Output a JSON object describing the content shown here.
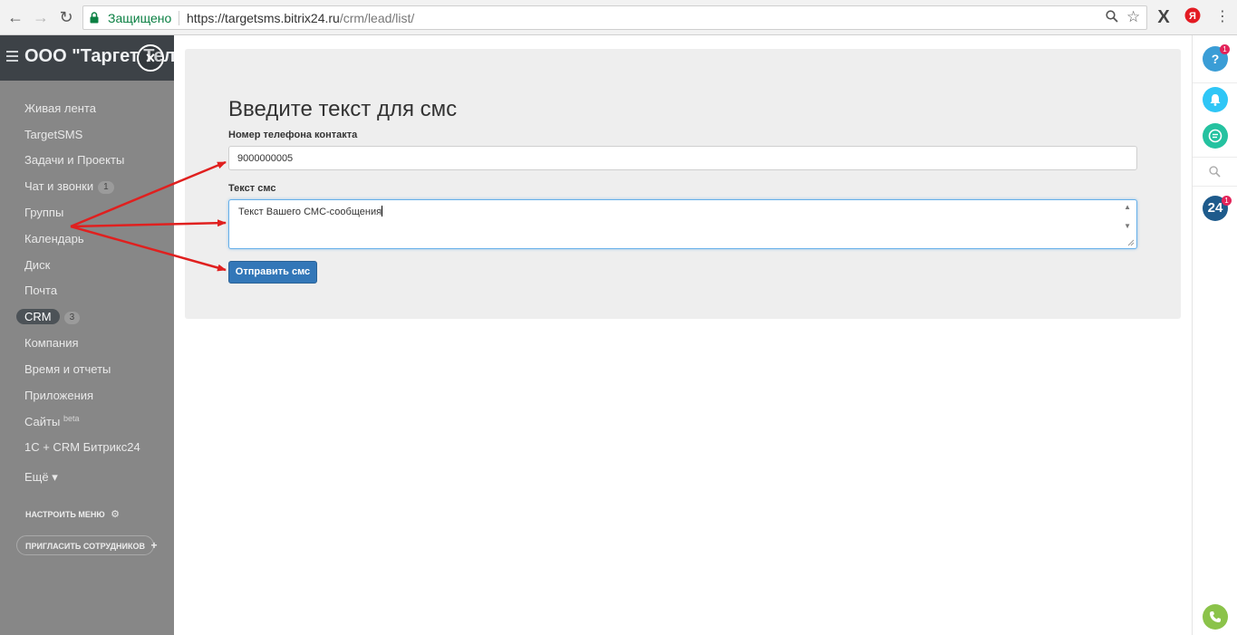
{
  "browser": {
    "secure_label": "Защищено",
    "url_host": "https://targetsms.bitrix24.ru",
    "url_path": "/crm/lead/list/"
  },
  "sidebar": {
    "company": "ООО \"Таргет Телеком\"",
    "items": [
      {
        "label": "Живая лента"
      },
      {
        "label": "TargetSMS"
      },
      {
        "label": "Задачи и Проекты"
      },
      {
        "label": "Чат и звонки",
        "counter": "1"
      },
      {
        "label": "Группы"
      },
      {
        "label": "Календарь"
      },
      {
        "label": "Диск"
      },
      {
        "label": "Почта"
      },
      {
        "label": "CRM",
        "counter": "3"
      },
      {
        "label": "Компания"
      },
      {
        "label": "Время и отчеты"
      },
      {
        "label": "Приложения"
      },
      {
        "label": "Сайты",
        "sup": "beta"
      },
      {
        "label": "1С + CRM Битрикс24"
      },
      {
        "label": "Ещё ▾"
      }
    ],
    "settings_label": "НАСТРОИТЬ МЕНЮ",
    "invite_label": "ПРИГЛАСИТЬ СОТРУДНИКОВ"
  },
  "form": {
    "title": "Введите текст для смс",
    "phone_label": "Номер телефона контакта",
    "phone_value": "9000000005",
    "sms_label": "Текст смс",
    "sms_value": "Текст Вашего СМС-сообщения",
    "send_label": "Отправить смс"
  },
  "rightbar": {
    "help_badge": "1",
    "b24_label": "24",
    "b24_badge": "1"
  },
  "colors": {
    "accent": "#3377b8",
    "sidebar_bg": "#878787",
    "header_bg": "#3d4247",
    "arrow": "#e0201f"
  }
}
